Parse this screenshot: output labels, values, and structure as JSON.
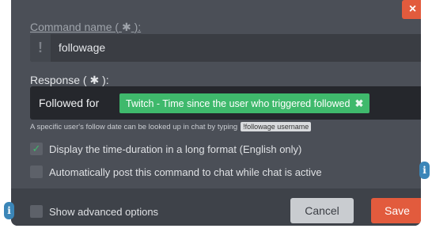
{
  "dialog": {
    "close_icon": "×",
    "command_name": {
      "label": "Command name (",
      "required_mark": "✱",
      "label_suffix": "):",
      "prefix_symbol": "!",
      "value": "followage"
    },
    "response": {
      "label": "Response (",
      "required_mark": "✱",
      "label_suffix": "):",
      "text": "Followed for",
      "variable_chip": "Twitch - Time since the user who triggered followed",
      "chip_remove": "✖"
    },
    "hint": {
      "text": "A specific user's follow date can be looked up in chat by typing",
      "code": "!followage username"
    },
    "options": [
      {
        "label": "Display the time-duration in a long format (English only)",
        "checked": true
      },
      {
        "label": "Automatically post this command to chat while chat is active",
        "checked": false
      }
    ],
    "advanced": {
      "label": "Show advanced options",
      "checked": false
    },
    "buttons": {
      "cancel": "Cancel",
      "save": "Save"
    },
    "info_icon": "i"
  },
  "colors": {
    "accent": "#e25b3d",
    "chip_green": "#3fb96c",
    "dialog_bg": "#4b4f57",
    "info_blue": "#3b86b8"
  }
}
